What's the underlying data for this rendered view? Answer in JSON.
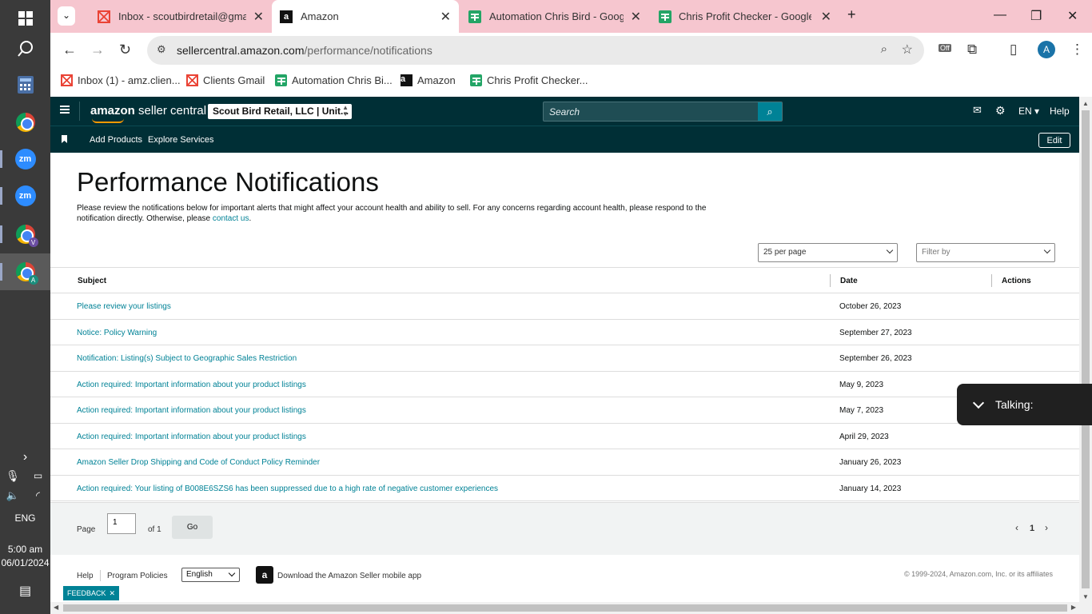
{
  "browser": {
    "tabs": [
      {
        "title": "Inbox - scoutbirdretail@gmail.c",
        "favicon": "gmail-icon"
      },
      {
        "title": "Amazon",
        "favicon": "amazon-icon",
        "active": true
      },
      {
        "title": "Automation Chris Bird - Google",
        "favicon": "sheets-icon"
      },
      {
        "title": "Chris Profit Checker - Google Sh",
        "favicon": "sheets-icon"
      }
    ],
    "url_host": "sellercentral.amazon.com",
    "url_path": "/performance/notifications",
    "extension_badge": "Off",
    "profile_initial": "A",
    "bookmarks": [
      {
        "label": "Inbox (1) - amz.clien...",
        "favicon": "gmail-icon"
      },
      {
        "label": "Clients Gmail",
        "favicon": "gmail-icon"
      },
      {
        "label": "Automation Chris Bi...",
        "favicon": "sheets-icon"
      },
      {
        "label": "Amazon",
        "favicon": "amazon-icon"
      },
      {
        "label": "Chris Profit Checker...",
        "favicon": "sheets-icon"
      }
    ]
  },
  "taskbar": {
    "zoom_label": "zm",
    "chrome_badge_v": "V",
    "chrome_badge_a": "A",
    "language": "ENG",
    "time": "5:00 am",
    "date": "06/01/2024"
  },
  "seller_central": {
    "logo_main": "amazon",
    "logo_sub": "seller central",
    "account": "Scout Bird Retail, LLC | Unit...",
    "search_placeholder": "Search",
    "language": "EN",
    "help": "Help",
    "sub_links": [
      "Add Products",
      "Explore Services"
    ],
    "edit": "Edit"
  },
  "page": {
    "title": "Performance Notifications",
    "description": "Please review the notifications below for important alerts that might affect your account health and ability to sell. For any concerns regarding account health, please respond to the notification directly. Otherwise, please ",
    "contact_link": "contact us",
    "per_page": "25 per page",
    "filter": "Filter by",
    "columns": {
      "subject": "Subject",
      "date": "Date",
      "actions": "Actions"
    },
    "rows": [
      {
        "subject": "Please review your listings",
        "date": "October 26, 2023"
      },
      {
        "subject": "Notice: Policy Warning",
        "date": "September 27, 2023"
      },
      {
        "subject": "Notification: Listing(s) Subject to Geographic Sales Restriction",
        "date": "September 26, 2023"
      },
      {
        "subject": "Action required: Important information about your product listings",
        "date": "May 9, 2023"
      },
      {
        "subject": "Action required: Important information about your product listings",
        "date": "May 7, 2023"
      },
      {
        "subject": "Action required: Important information about your product listings",
        "date": "April 29, 2023"
      },
      {
        "subject": "Amazon Seller Drop Shipping and Code of Conduct Policy Reminder",
        "date": "January 26, 2023"
      },
      {
        "subject": "Action required: Your listing of B008E6SZS6 has been suppressed due to a high rate of negative customer experiences",
        "date": "January 14, 2023"
      }
    ],
    "pager": {
      "page_label": "Page",
      "page_value": "1",
      "of_label": "of 1",
      "go": "Go",
      "current": "1"
    }
  },
  "footer": {
    "help": "Help",
    "policies": "Program Policies",
    "language": "English",
    "app": "Download the Amazon Seller mobile app",
    "copyright": "© 1999-2024, Amazon.com, Inc. or its affiliates"
  },
  "feedback": "FEEDBACK",
  "talking": "Talking:",
  "colors": {
    "teal": "#008296",
    "header": "#002f36",
    "tabstrip": "#f6c6cf"
  }
}
